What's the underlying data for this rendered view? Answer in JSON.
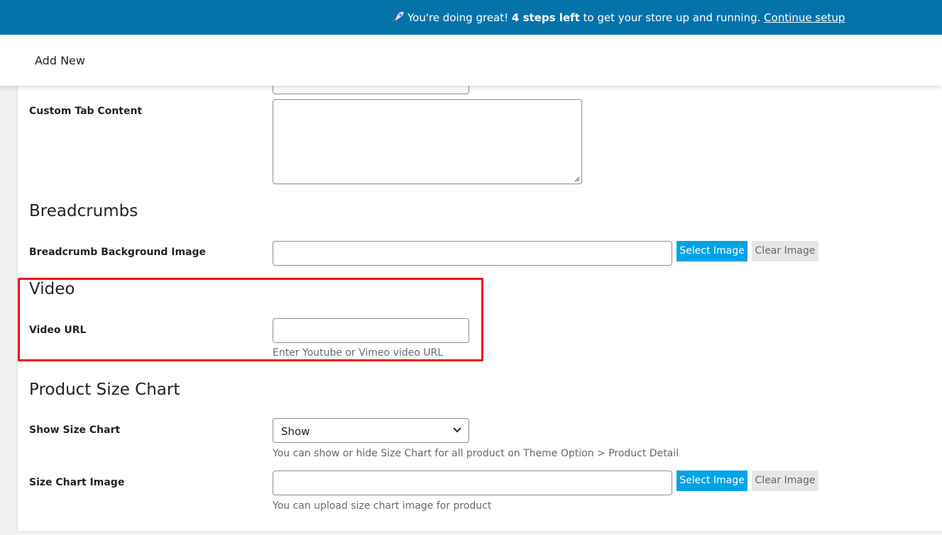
{
  "notice": {
    "prefix": "You're doing great! ",
    "steps": "4 steps left",
    "suffix": " to get your store up and running. ",
    "link": "Continue setup",
    "icon": "rocket-icon",
    "background": "#0473aa"
  },
  "header": {
    "title": "Add New"
  },
  "custom_tab": {
    "label": "Custom Tab Content",
    "value": ""
  },
  "breadcrumbs": {
    "title": "Breadcrumbs",
    "bg_label": "Breadcrumb Background Image",
    "bg_value": "",
    "select_label": "Select Image",
    "clear_label": "Clear Image"
  },
  "video": {
    "title": "Video",
    "url_label": "Video URL",
    "url_value": "",
    "help": "Enter Youtube or Vimeo video URL",
    "highlight_color": "#ee1111"
  },
  "size_chart": {
    "title": "Product Size Chart",
    "show_label": "Show Size Chart",
    "show_selected": "Show",
    "show_help": "You can show or hide Size Chart for all product on Theme Option > Product Detail",
    "image_label": "Size Chart Image",
    "image_value": "",
    "select_label": "Select Image",
    "clear_label": "Clear Image",
    "image_help": "You can upload size chart image for product"
  },
  "colors": {
    "primary_button": "#00a3e8",
    "secondary_button": "#e6e6e6"
  }
}
